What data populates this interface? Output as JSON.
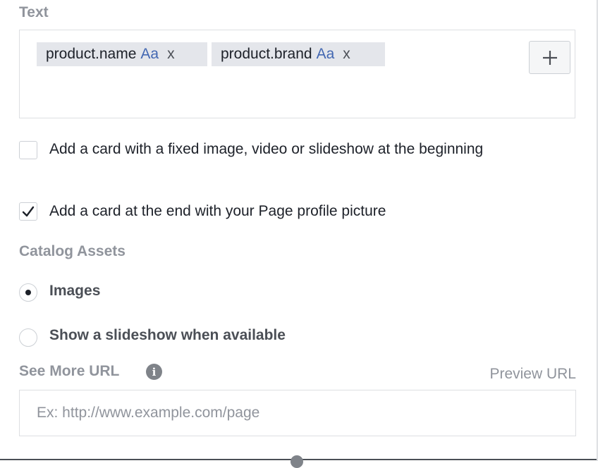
{
  "text_section": {
    "label": "Text",
    "tokens": [
      {
        "name": "product.name",
        "format_icon": "Aa",
        "remove": "x"
      },
      {
        "name": "product.brand",
        "format_icon": "Aa",
        "remove": "x"
      }
    ],
    "add_button": "+"
  },
  "options": {
    "fixed_card": {
      "label": "Add a card with a fixed image, video or slideshow at the beginning",
      "checked": false
    },
    "end_card": {
      "label": "Add a card at the end with your Page profile picture",
      "checked": true
    }
  },
  "catalog_assets": {
    "label": "Catalog Assets",
    "choices": [
      {
        "label": "Images",
        "selected": true
      },
      {
        "label": "Show a slideshow when available",
        "selected": false
      }
    ]
  },
  "see_more_url": {
    "label": "See More URL",
    "info_icon": "info-icon",
    "preview_link": "Preview URL",
    "placeholder": "Ex: http://www.example.com/page",
    "value": ""
  },
  "colors": {
    "label_gray": "#90949c",
    "border": "#dddfe2",
    "token_bg": "#e4e6eb",
    "accent_blue": "#4267b2"
  }
}
